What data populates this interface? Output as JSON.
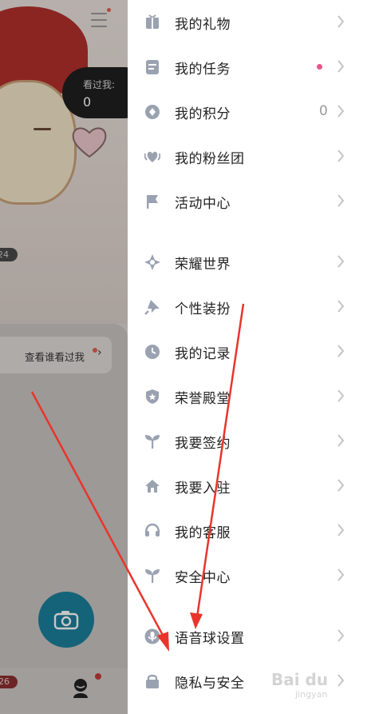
{
  "background": {
    "viewed_label": "看过我:",
    "viewed_count": "0",
    "level_badge": "24",
    "who_viewed_text": "查看谁看过我",
    "tab_badge": "26",
    "camera_icon": "camera-icon",
    "profile_icon": "profile-icon"
  },
  "drawer": {
    "items": [
      {
        "label": "我的礼物",
        "icon": "gift-icon"
      },
      {
        "label": "我的任务",
        "icon": "task-icon",
        "has_dot": true
      },
      {
        "label": "我的积分",
        "icon": "points-icon",
        "value": "0"
      },
      {
        "label": "我的粉丝团",
        "icon": "fan-club-icon"
      },
      {
        "label": "活动中心",
        "icon": "flag-icon"
      },
      {
        "label": "荣耀世界",
        "icon": "compass-icon"
      },
      {
        "label": "个性装扮",
        "icon": "pin-icon"
      },
      {
        "label": "我的记录",
        "icon": "clock-icon"
      },
      {
        "label": "荣誉殿堂",
        "icon": "shield-star-icon"
      },
      {
        "label": "我要签约",
        "icon": "sprout-icon"
      },
      {
        "label": "我要入驻",
        "icon": "home-icon"
      },
      {
        "label": "我的客服",
        "icon": "headset-icon"
      },
      {
        "label": "安全中心",
        "icon": "sprout-icon"
      },
      {
        "label": "语音球设置",
        "icon": "microphone-icon"
      },
      {
        "label": "隐私与安全",
        "icon": "lock-icon"
      }
    ]
  },
  "colors": {
    "icon": "#9aa2b1",
    "chevron": "#c4c4c4",
    "task_dot": "#e8548a",
    "arrow": "#e8352b",
    "camera_button": "#1c7f9a"
  },
  "watermark": {
    "text": "Bai du",
    "sub": "jingyan"
  }
}
